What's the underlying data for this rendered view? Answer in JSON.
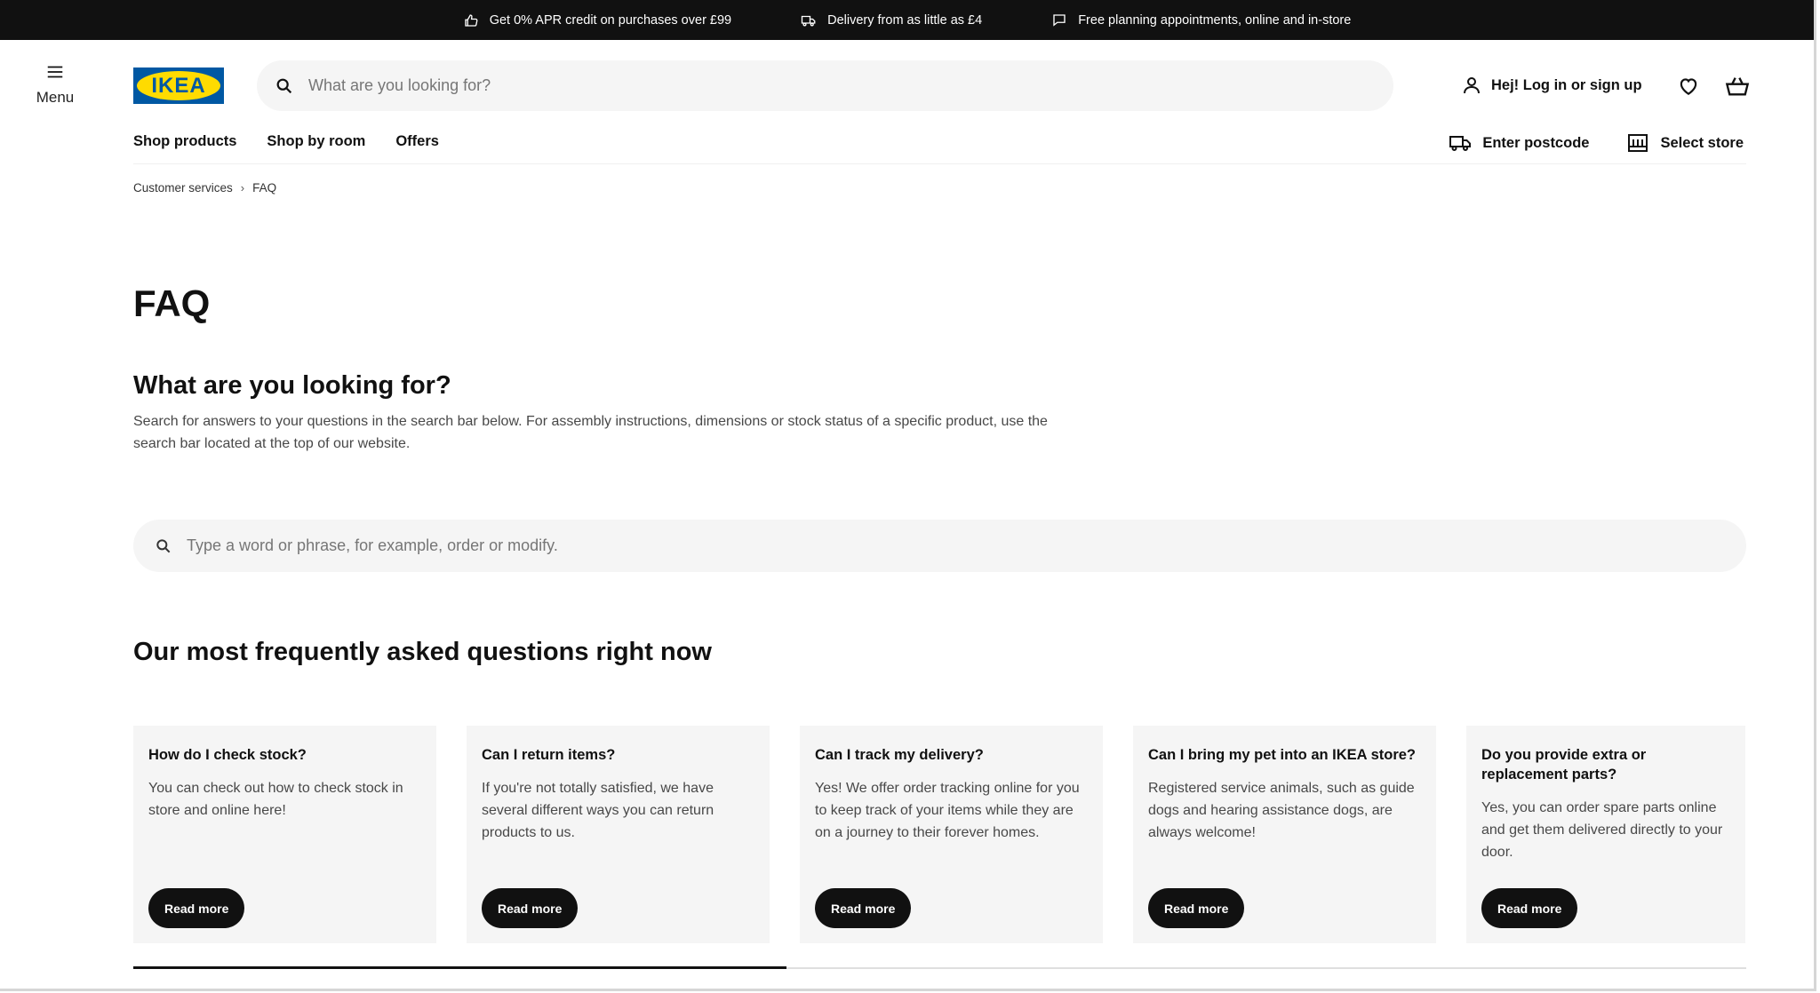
{
  "banner": {
    "items": [
      {
        "icon": "thumbs-up-icon",
        "text": "Get 0% APR credit on purchases over £99"
      },
      {
        "icon": "delivery-truck-icon",
        "text": "Delivery from as little as £4"
      },
      {
        "icon": "chat-bubble-icon",
        "text": "Free planning appointments, online and in-store"
      }
    ]
  },
  "header": {
    "menu_label": "Menu",
    "logo_text": "IKEA",
    "search_placeholder": "What are you looking for?",
    "login_label": "Hej! Log in or sign up"
  },
  "nav": {
    "left": [
      "Shop products",
      "Shop by room",
      "Offers"
    ],
    "postcode_label": "Enter postcode",
    "store_label": "Select store"
  },
  "breadcrumb": {
    "items": [
      "Customer services",
      "FAQ"
    ],
    "separator": "›"
  },
  "main": {
    "title": "FAQ",
    "subtitle": "What are you looking for?",
    "intro": "Search for answers to your questions in the search bar below. For assembly instructions, dimensions or stock status of a specific product, use the search bar located at the top of our website.",
    "faq_search_placeholder": "Type a word or phrase, for example, order or modify.",
    "faq_heading": "Our most frequently asked questions right now"
  },
  "cards": [
    {
      "question": "How do I check stock?",
      "answer": "You can check out how to check stock in store and online here!",
      "button": "Read more"
    },
    {
      "question": "Can I return items?",
      "answer": "If you're not totally satisfied, we have several different ways you can return products to us.",
      "button": "Read more"
    },
    {
      "question": "Can I track my delivery?",
      "answer": "Yes! We offer order tracking online for you to keep track of your items while they are on a journey to their forever homes.",
      "button": "Read more"
    },
    {
      "question": "Can I bring my pet into an IKEA store?",
      "answer": "Registered service animals, such as guide dogs and hearing assistance dogs, are always welcome!",
      "button": "Read more"
    },
    {
      "question": "Do you provide extra or replacement parts?",
      "answer": "Yes, you can order spare parts online and get them delivered directly to your door.",
      "button": "Read more"
    }
  ],
  "carousel": {
    "progress": 0.405
  },
  "colors": {
    "banner_bg": "#111111",
    "logo_blue": "#0058a3",
    "logo_yellow": "#ffdb00",
    "card_bg": "#f5f5f5"
  }
}
